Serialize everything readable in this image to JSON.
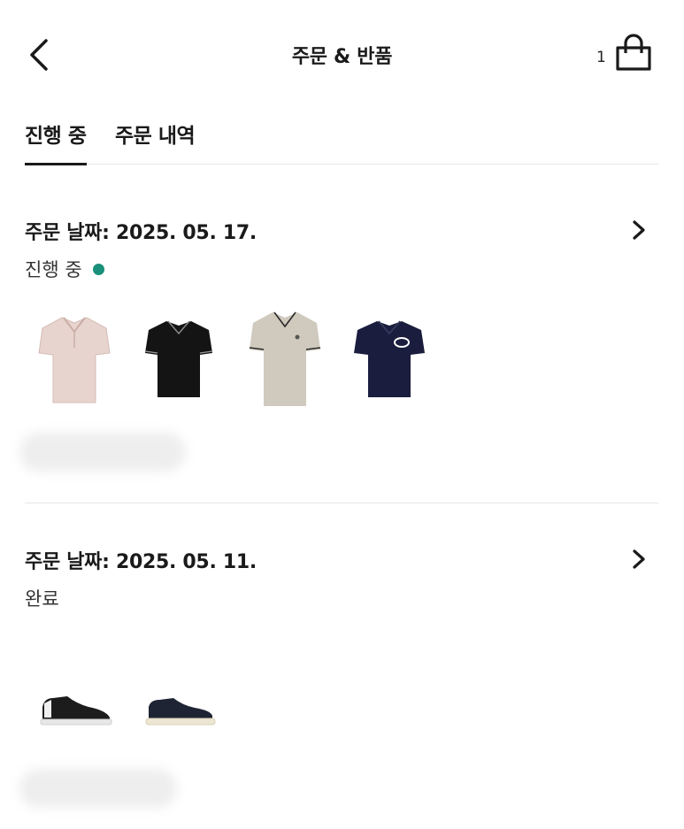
{
  "header": {
    "title": "주문 & 반품",
    "cart_count": "1"
  },
  "tabs": [
    {
      "label": "진행 중",
      "active": true
    },
    {
      "label": "주문 내역",
      "active": false
    }
  ],
  "orders": [
    {
      "date_label": "주문 날짜: 2025. 05. 17.",
      "status": "진행 중",
      "status_color": "#1a8f7a",
      "items": [
        {
          "icon": "polo-shirt-pink-icon",
          "color": "#e8d4ce"
        },
        {
          "icon": "polo-shirt-black-icon",
          "color": "#141414"
        },
        {
          "icon": "polo-shirt-beige-icon",
          "color": "#cfcabd"
        },
        {
          "icon": "polo-shirt-navy-icon",
          "color": "#1a1d3d"
        }
      ]
    },
    {
      "date_label": "주문 날짜: 2025. 05. 11.",
      "status": "완료",
      "items": [
        {
          "icon": "sneaker-black-icon",
          "color": "#1c1c1c"
        },
        {
          "icon": "sneaker-navy-icon",
          "color": "#1e2433"
        }
      ]
    }
  ]
}
